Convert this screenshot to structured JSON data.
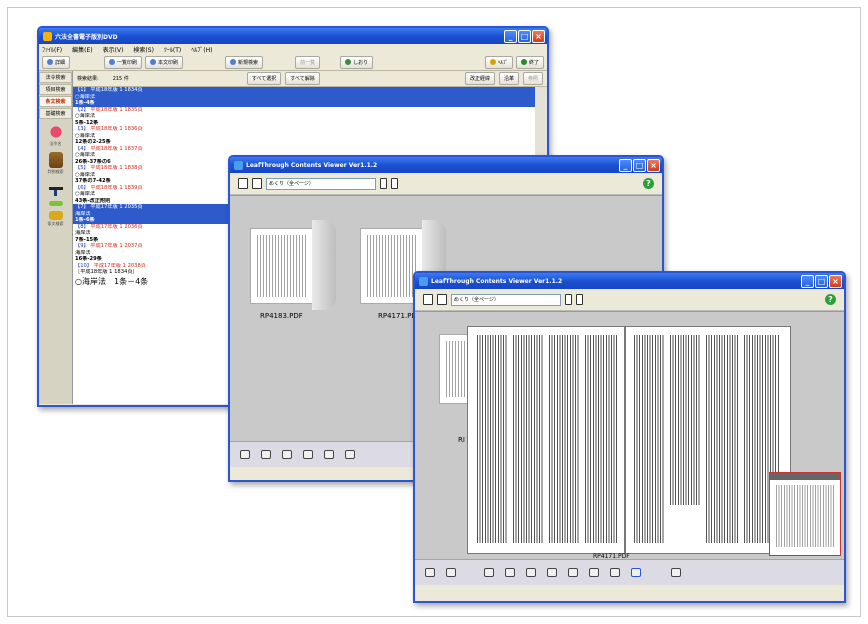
{
  "app": {
    "title": "六法全書電子版別DVD",
    "menus": [
      "ﾌｧｲﾙ(F)",
      "編集(E)",
      "表示(V)",
      "検索(S)",
      "ﾂｰﾙ(T)",
      "ﾍﾙﾌﾟ(H)"
    ],
    "sidebar": [
      "法令検索",
      "項目検索",
      "条文検索",
      "基礎検索"
    ],
    "sidebar_icons": [
      "法令名",
      "判例検索",
      "",
      "",
      "条文検索"
    ],
    "toolbar": [
      "詳細",
      "一覧印刷",
      "本文印刷",
      "新規検索",
      "前一覧",
      "しおり",
      "ﾍﾙﾌﾟ",
      "終了"
    ],
    "search_result_label": "検索結果:",
    "search_result_count": "215 件",
    "buttons": [
      "すべて選択",
      "すべて解除",
      "改正経緯",
      "沿革",
      "参照"
    ],
    "results": [
      {
        "kind": "h",
        "sel": true,
        "text": "【1】 ",
        "year": "平成18年版 1 1834頁"
      },
      {
        "kind": "n",
        "sel": true,
        "text": "○海岸法"
      },
      {
        "kind": "b",
        "sel": true,
        "text": "1条-4条"
      },
      {
        "kind": "h",
        "text": "【2】 ",
        "year": "平成18年版 1 1835頁"
      },
      {
        "kind": "n",
        "text": "○海岸法"
      },
      {
        "kind": "b",
        "text": "5条-12条"
      },
      {
        "kind": "h",
        "text": "【3】 ",
        "year": "平成18年版 1 1836頁"
      },
      {
        "kind": "n",
        "text": "○海岸法"
      },
      {
        "kind": "b",
        "text": "12条の2-25条"
      },
      {
        "kind": "h",
        "text": "【4】 ",
        "year": "平成18年版 1 1837頁"
      },
      {
        "kind": "n",
        "text": "○海岸法"
      },
      {
        "kind": "b",
        "text": "26条-37条の6"
      },
      {
        "kind": "h",
        "text": "【5】 ",
        "year": "平成18年版 1 1838頁"
      },
      {
        "kind": "n",
        "text": "○海岸法"
      },
      {
        "kind": "b",
        "text": "37条の7-42条"
      },
      {
        "kind": "h",
        "text": "【6】 ",
        "year": "平成18年版 1 1839頁"
      },
      {
        "kind": "n",
        "text": "○海岸法"
      },
      {
        "kind": "b",
        "text": "43条-改正附則"
      },
      {
        "kind": "h",
        "sel": true,
        "text": "【7】 ",
        "year": "平成17年版 1 2035頁"
      },
      {
        "kind": "n",
        "sel": true,
        "text": "海岸法"
      },
      {
        "kind": "b",
        "sel": true,
        "text": "1条-6条"
      },
      {
        "kind": "h",
        "text": "【8】 ",
        "year": "平成17年版 1 2036頁"
      },
      {
        "kind": "n",
        "text": "海岸法"
      },
      {
        "kind": "b",
        "text": "7条-15条"
      },
      {
        "kind": "h",
        "text": "【9】 ",
        "year": "平成17年版 1 2037頁"
      },
      {
        "kind": "n",
        "text": "海岸法"
      },
      {
        "kind": "b",
        "text": "16条-29条"
      },
      {
        "kind": "h",
        "text": "【10】 ",
        "year": "平成17年版 1 2038頁"
      },
      {
        "kind": "n",
        "text": "［平成18年版 1 1834頁］"
      }
    ],
    "detail_text": "○海岸法　1条－4条"
  },
  "viewer_back": {
    "title": "LeafThrough Contents Viewer Ver1.1.2",
    "combo": "めくり（全ページ）",
    "files": [
      "RP4183.PDF",
      "RP4171.PDF"
    ]
  },
  "viewer_front": {
    "title": "LeafThrough Contents Viewer Ver1.1.2",
    "combo": "めくり（全ページ）",
    "partial_file_label": "RI",
    "bottom_file_label": "RP4171.PDF"
  },
  "colors": {
    "titlebar": "#1a4fd0",
    "selection": "#2e5bcc",
    "year": "#d42b1c"
  }
}
